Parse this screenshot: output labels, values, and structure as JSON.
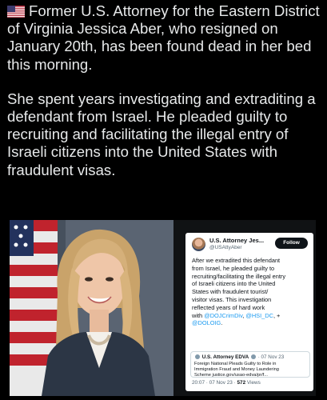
{
  "post": {
    "flag_icon": "us-flag-icon",
    "paragraph1": "Former U.S. Attorney for the Eastern District of Virginia Jessica Aber, who resigned on January 20th, has been found dead in her bed this morning.",
    "paragraph2": "She spent years investigating and extraditing a defendant from Israel. He pleaded guilty to recruiting and facilitating the illegal entry of Israeli citizens into the United States with fraudulent visas."
  },
  "tweet": {
    "display_name": "U.S. Attorney Jes...",
    "handle": "@USAttyAber",
    "follow_label": "Follow",
    "body_lines": [
      "After we extradited this defendant",
      "from Israel, he pleaded guilty to",
      "recruiting/facilitating the illegal entry",
      "of Israeli citizens into the United",
      "States with fraudulent tourist/",
      "visitor visas. This investigation",
      "reflected years of hard work"
    ],
    "with_text": "with ",
    "mention1": "@DOJCrimDiv",
    "sep1": ", ",
    "mention2": "@HSI_DC",
    "sep2": ", +",
    "mention3": "@DOLOIG",
    "mention3_suffix": ".",
    "quote": {
      "name": "U.S. Attorney EDVA",
      "date": "· 07 Nov 23",
      "body_lines": [
        "Foreign National Pleads Guilty to Role in",
        "Immigration Fraud and Money Laundering",
        "Scheme justice.gov/usao-edva/pr/f..."
      ]
    },
    "time": "20:07 · 07 Nov 23 · ",
    "views_count": "572",
    "views_label": " Views"
  }
}
